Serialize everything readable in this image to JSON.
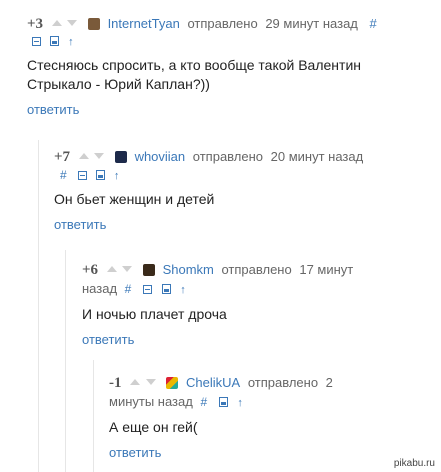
{
  "comments": [
    {
      "rating": "+3",
      "user": "InternetTyan",
      "sent_label": "отправлено",
      "time_line1": "29 минут назад",
      "time_line2": "",
      "hash": "#",
      "text": "Стесняюсь спросить, а кто вообще такой Валентин Стрыкало - Юрий Каплан?))",
      "reply_label": "ответить",
      "avatar_color": "#7a5a3a"
    },
    {
      "rating": "+7",
      "user": "whoviian",
      "sent_label": "отправлено",
      "time_line1": "20 минут назад",
      "time_line2": "",
      "hash": "#",
      "text": "Он бьет женщин и детей",
      "reply_label": "ответить",
      "avatar_color": "#1d2a4a"
    },
    {
      "rating": "+6",
      "user": "Shomkm",
      "sent_label": "отправлено",
      "time_line1": "17 минут",
      "time_line2": "назад",
      "hash": "#",
      "text": "И ночью плачет дроча",
      "reply_label": "ответить",
      "avatar_color": "#3a2a1a"
    },
    {
      "rating": "-1",
      "user": "ChelikUA",
      "sent_label": "отправлено",
      "time_line1": "2",
      "time_line2": "минуты назад",
      "hash": "#",
      "text": "А еще он гей(",
      "reply_label": "ответить",
      "avatar_color": "#c8a020"
    }
  ],
  "tool_icons": [
    "collapse-icon",
    "save-icon",
    "parent-up-icon"
  ],
  "watermark": "pikabu.ru",
  "colors": {
    "link": "#3b78b8",
    "text": "#222222",
    "meta": "#666666",
    "arrow": "#cfcfcf",
    "thread_line": "#e6e6e6"
  }
}
